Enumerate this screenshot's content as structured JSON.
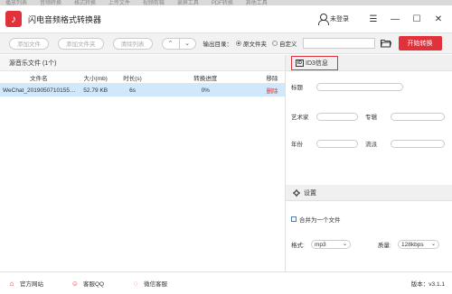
{
  "topmenu": [
    "播放列表",
    "音频转换",
    "格式转换",
    "上传文件",
    "视频剪辑",
    "录屏工具",
    "PDF转换",
    "其他工具"
  ],
  "app": {
    "title": "闪电音频格式转换器",
    "user_label": "未登录"
  },
  "window_controls": {
    "menu": "☰",
    "minimize": "—",
    "maximize": "☐",
    "close": "✕"
  },
  "toolbar": {
    "add_file": "添加文件",
    "add_folder": "添加文件夹",
    "clear_list": "清除列表",
    "up": "⌃",
    "down": "⌄",
    "output_label": "输出目录：",
    "radio_original": "原文件夹",
    "radio_custom": "自定义",
    "path_value": "",
    "convert_label": "开始转换"
  },
  "filelist": {
    "header": "源音乐文件 (1个)",
    "columns": [
      "文件名",
      "大小(mb)",
      "时长(s)",
      "转换进度",
      "移除"
    ],
    "rows": [
      {
        "name": "WeChat_20190507101554.mp3",
        "size": "52.79 KB",
        "duration": "6s",
        "progress": "0%",
        "remove": "删除"
      }
    ]
  },
  "id3": {
    "header": "ID3信息",
    "badge": "ID",
    "title_label": "标题",
    "artist_label": "艺术家",
    "album_label": "专辑",
    "year_label": "年份",
    "genre_label": "流派"
  },
  "settings": {
    "header": "设置",
    "merge_label": "合并为一个文件",
    "format_label": "格式:",
    "format_value": "mp3",
    "quality_label": "质量:",
    "quality_value": "128kbps"
  },
  "statusbar": {
    "website": "官方网站",
    "qq": "客服QQ",
    "wechat": "微信客服",
    "version": "版本：v3.1.1"
  },
  "colors": {
    "accent": "#e1313b",
    "selected_row": "#cfe8fb"
  }
}
